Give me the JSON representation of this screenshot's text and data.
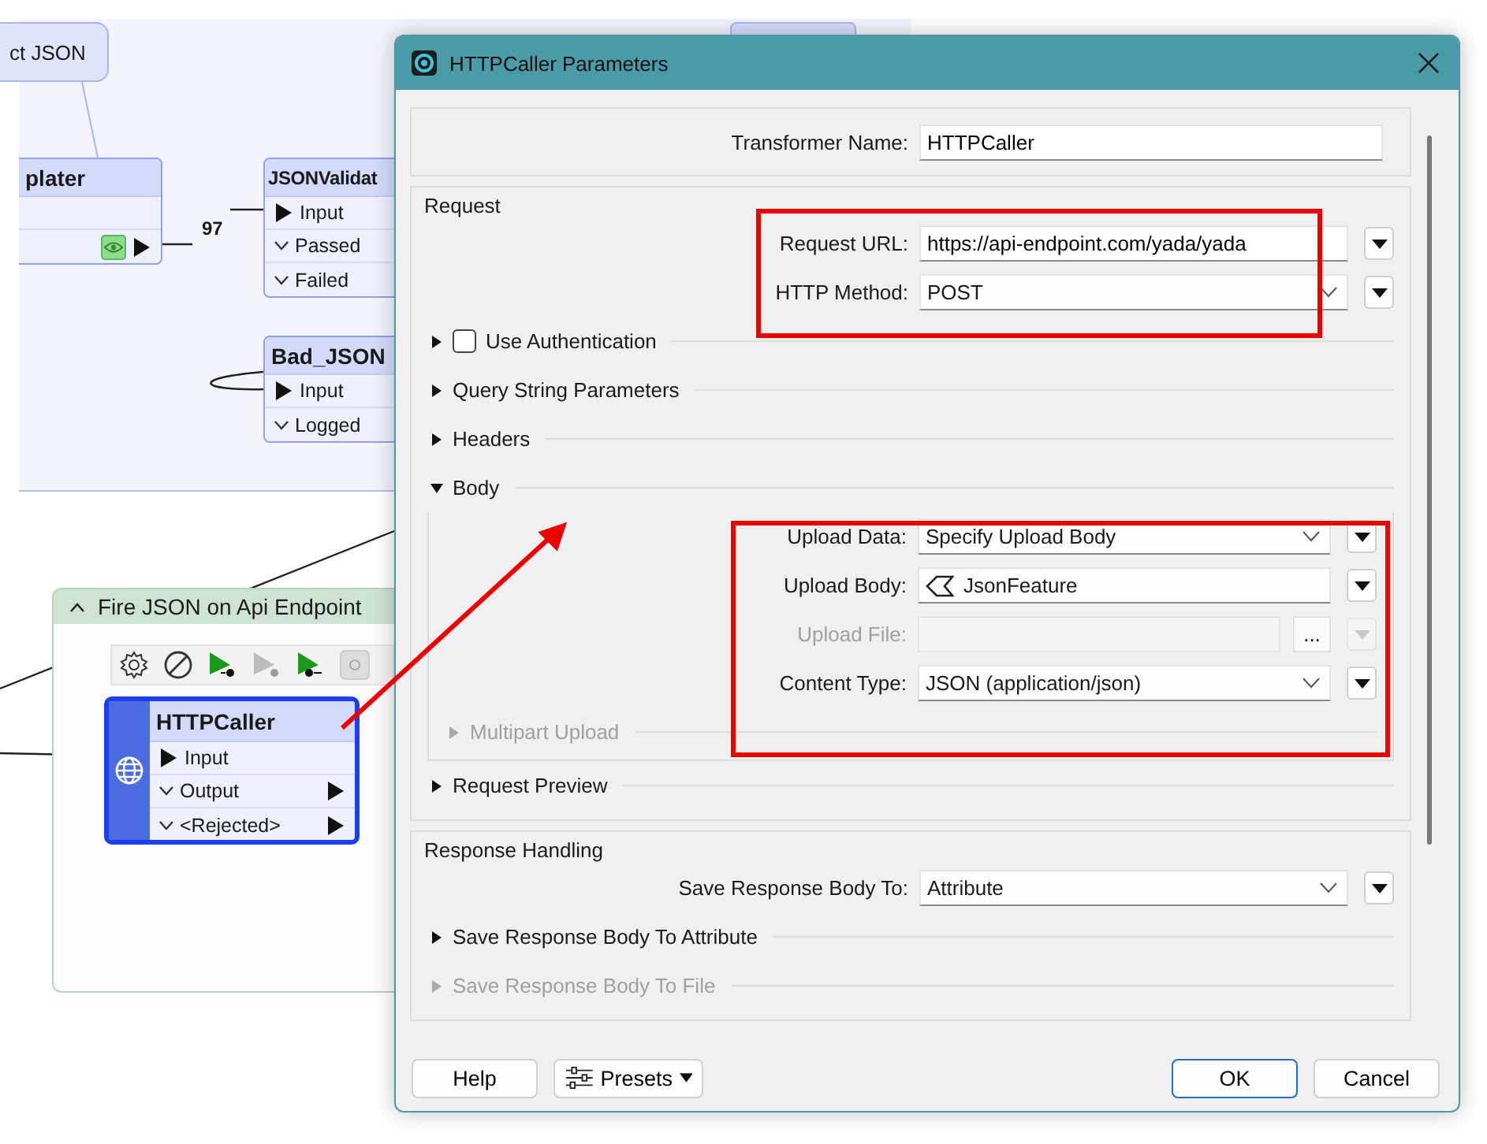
{
  "canvas": {
    "annotation": "ct JSON",
    "nodes": [
      {
        "title": "plater",
        "ports": [
          {
            "kind": "input",
            "connected": false
          },
          {
            "kind": "output",
            "connected": true,
            "inspect": true
          }
        ]
      },
      {
        "title": "JSONValidat",
        "ports": [
          {
            "kind": "input",
            "label": "Input",
            "connected": true
          },
          {
            "kind": "output",
            "label": "Passed",
            "connected": false
          },
          {
            "kind": "output",
            "label": "Failed",
            "connected": false
          }
        ]
      },
      {
        "title": "Bad_JSON",
        "ports": [
          {
            "kind": "input",
            "label": "Input",
            "connected": true
          },
          {
            "kind": "output",
            "label": "Logged",
            "connected": false
          }
        ]
      }
    ],
    "connection_count": "97",
    "bookmark": {
      "title": "Fire JSON on Api Endpoint",
      "expanded": true
    },
    "transformer": {
      "title": "HTTPCaller",
      "selected": true,
      "ports": [
        {
          "kind": "input",
          "label": "Input",
          "connected": true
        },
        {
          "kind": "output",
          "label": "Output",
          "connected": true
        },
        {
          "kind": "output",
          "label": "<Rejected>",
          "connected": true
        }
      ]
    }
  },
  "dialog": {
    "title": "HTTPCaller Parameters",
    "transformer_name": {
      "kind": "text",
      "label": "Transformer Name:",
      "value": "HTTPCaller",
      "has_menu": false,
      "disabled": false
    },
    "sections": [
      {
        "title": "Request",
        "items": [
          {
            "kind": "text",
            "label": "Request URL:",
            "value": "https://api-endpoint.com/yada/yada",
            "has_menu": true,
            "disabled": false
          },
          {
            "kind": "dropdown",
            "label": "HTTP Method:",
            "value": "POST",
            "has_menu": true,
            "disabled": false
          },
          {
            "kind": "expander",
            "label": "Use Authentication",
            "expanded": false,
            "disabled": false,
            "checked": false
          },
          {
            "kind": "expander",
            "label": "Query String Parameters",
            "expanded": false,
            "disabled": false
          },
          {
            "kind": "expander",
            "label": "Headers",
            "expanded": false,
            "disabled": false
          },
          {
            "kind": "expander",
            "label": "Body",
            "expanded": true,
            "disabled": false,
            "children": [
              {
                "kind": "dropdown",
                "label": "Upload Data:",
                "value": "Specify Upload Body",
                "has_menu": true,
                "disabled": false
              },
              {
                "kind": "attribute",
                "label": "Upload Body:",
                "value": "JsonFeature",
                "has_menu": true,
                "disabled": false
              },
              {
                "kind": "file",
                "label": "Upload File:",
                "browse": "...",
                "has_menu": true,
                "disabled": true
              },
              {
                "kind": "dropdown",
                "label": "Content Type:",
                "value": "JSON (application/json)",
                "has_menu": true,
                "disabled": false
              },
              {
                "kind": "expander",
                "label": "Multipart Upload",
                "expanded": false,
                "disabled": true
              }
            ]
          },
          {
            "kind": "expander",
            "label": "Request Preview",
            "expanded": false,
            "disabled": false
          }
        ]
      },
      {
        "title": "Response Handling",
        "items": [
          {
            "kind": "dropdown",
            "label": "Save Response Body To:",
            "value": "Attribute",
            "has_menu": true,
            "disabled": false
          },
          {
            "kind": "expander",
            "label": "Save Response Body To Attribute",
            "expanded": false,
            "disabled": false
          },
          {
            "kind": "expander",
            "label": "Save Response Body To File",
            "expanded": false,
            "disabled": true
          }
        ]
      }
    ],
    "buttons": [
      {
        "kind": "help",
        "label": "Help"
      },
      {
        "kind": "presets",
        "label": "Presets"
      },
      {
        "kind": "ok",
        "label": "OK"
      },
      {
        "kind": "cancel",
        "label": "Cancel"
      }
    ]
  }
}
